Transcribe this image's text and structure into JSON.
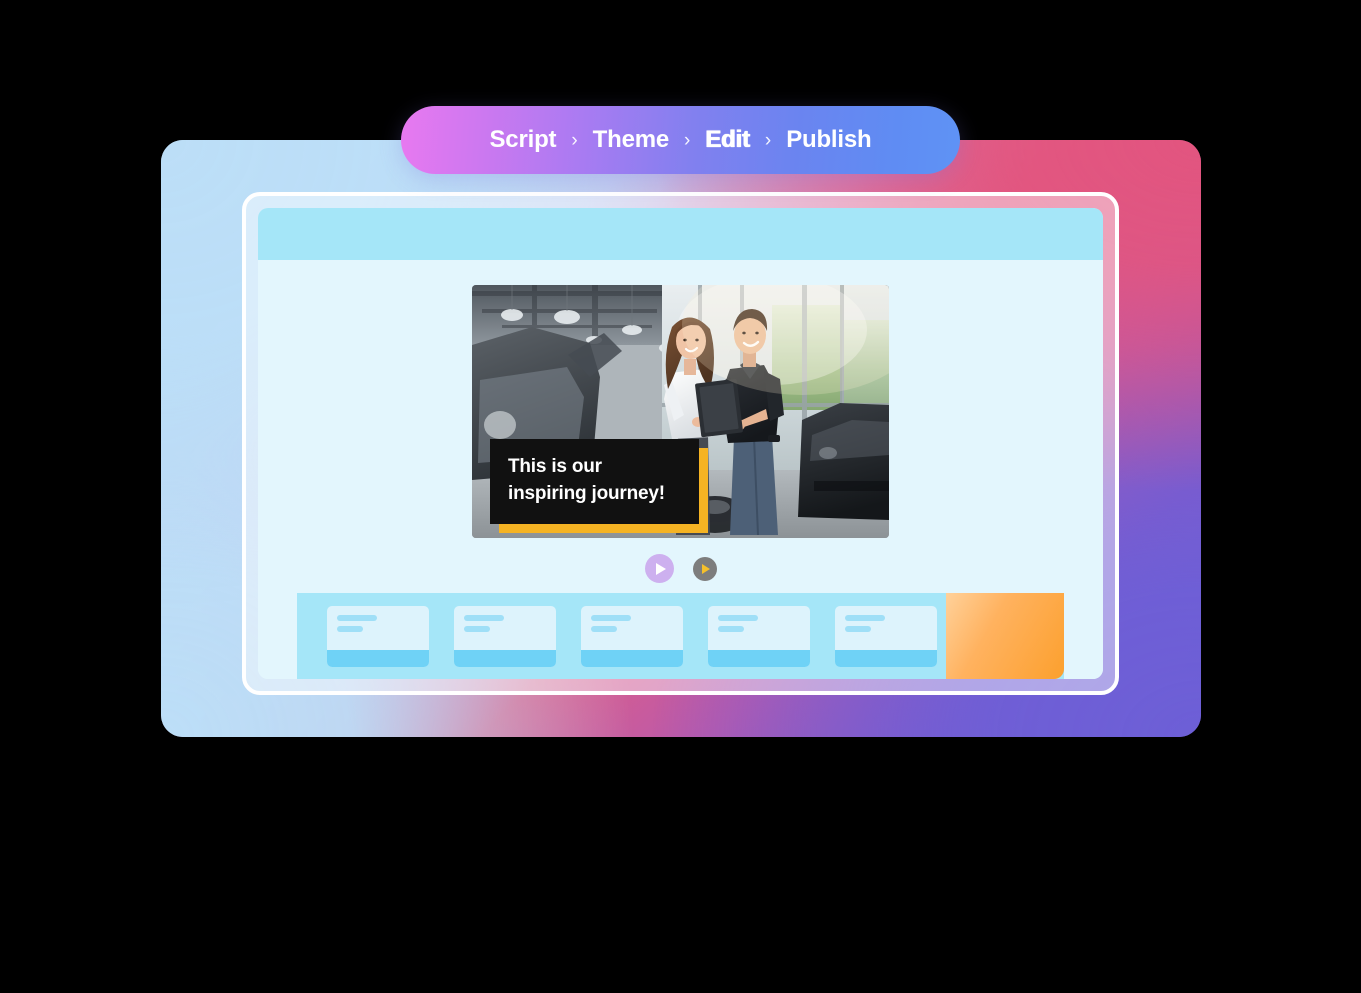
{
  "breadcrumb": {
    "separator": "›",
    "steps": [
      {
        "label": "Script",
        "active": false
      },
      {
        "label": "Theme",
        "active": false
      },
      {
        "label": "Edit",
        "active": true
      },
      {
        "label": "Publish",
        "active": false
      }
    ]
  },
  "editor": {
    "titlebar": {
      "color": "#a5e6f8"
    },
    "preview": {
      "scene_description": "Two people in a car dealership showroom looking at a tablet",
      "caption": {
        "line1": "This is our",
        "line2": "inspiring journey!",
        "background": "#111111",
        "text_color": "#ffffff",
        "accent_color": "#f5b323"
      }
    },
    "controls": {
      "play_primary": {
        "icon": "play-icon",
        "color": "#cdb0ef",
        "glyph_color": "#ffffff"
      },
      "play_secondary": {
        "icon": "play-icon",
        "color": "#7d7d7d",
        "glyph_color": "#f5c02b"
      }
    },
    "timeline": {
      "background": "#a5e6f8",
      "clips": [
        {
          "id": "clip-1"
        },
        {
          "id": "clip-2"
        },
        {
          "id": "clip-3"
        },
        {
          "id": "clip-4"
        },
        {
          "id": "clip-5"
        },
        {
          "id": "clip-6"
        }
      ],
      "overlay": {
        "name": "add-clip-highlight",
        "color": "#fca02e"
      }
    }
  },
  "colors": {
    "card_top_left": "#bcdef7",
    "card_top_right": "#e2557f",
    "card_bottom_right": "#6d5fd6",
    "card_bottom_left": "#bcdef7",
    "window_body": "#e3f6fd",
    "clip_body": "#ddf3fc",
    "clip_bar": "#6fd2f6"
  }
}
